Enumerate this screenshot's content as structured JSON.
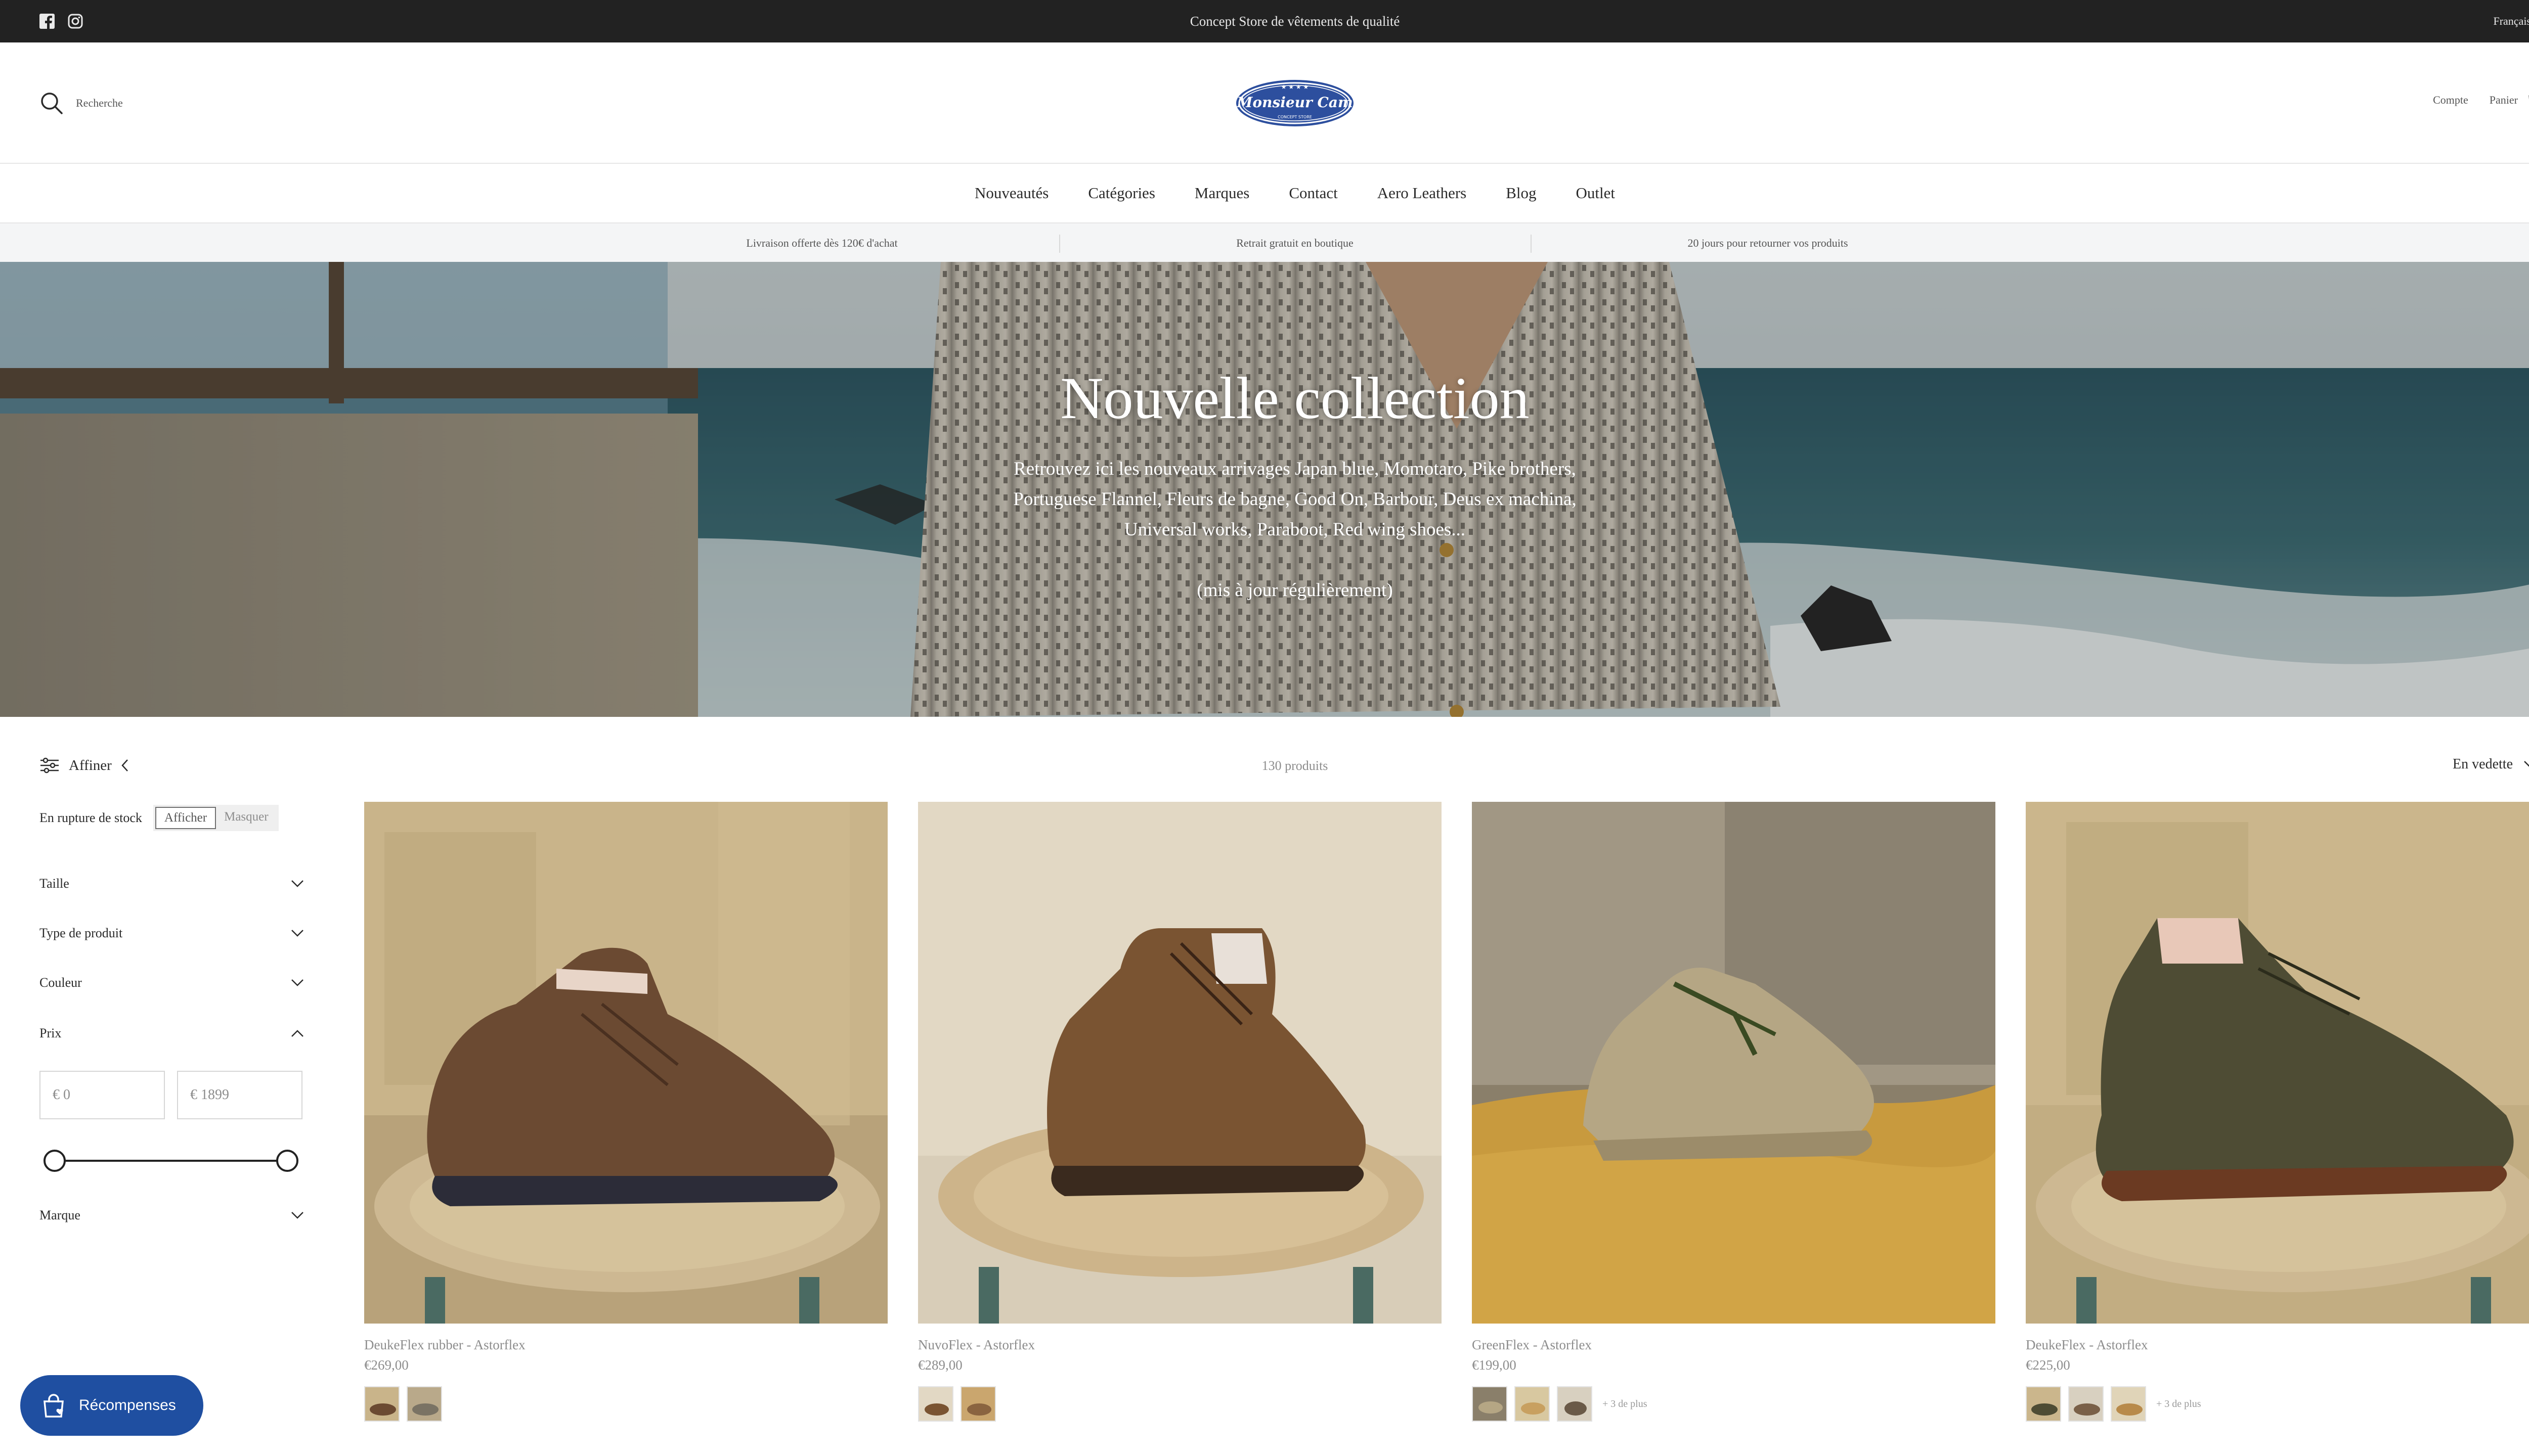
{
  "topbar": {
    "announcement": "Concept Store de vêtements de qualité",
    "language": "Français",
    "social_icons": [
      "facebook-icon",
      "instagram-icon"
    ]
  },
  "header": {
    "search_label": "Recherche",
    "logo_text": "Monsieur Cam",
    "account_label": "Compte",
    "cart_label": "Panier"
  },
  "nav": {
    "items": [
      "Nouveautés",
      "Catégories",
      "Marques",
      "Contact",
      "Aero Leathers",
      "Blog",
      "Outlet"
    ]
  },
  "usp": {
    "items": [
      "Livraison offerte dès 120€ d'achat",
      "Retrait gratuit en boutique",
      "20 jours pour retourner vos produits"
    ]
  },
  "hero": {
    "title": "Nouvelle collection",
    "description": "Retrouvez ici les nouveaux arrivages Japan blue, Momotaro, Pike brothers, Portuguese Flannel, Fleurs de bagne, Good On, Barbour, Deus ex machina, Universal works, Paraboot, Red wing shoes...",
    "note": "(mis à jour régulièrement)"
  },
  "filters": {
    "refine_label": "Affiner",
    "stock_label": "En rupture de stock",
    "stock_options": [
      "Afficher",
      "Masquer"
    ],
    "stock_selected": "Afficher",
    "facets": [
      "Taille",
      "Type de produit",
      "Couleur",
      "Prix",
      "Marque"
    ],
    "price_min": "€ 0",
    "price_max": "€ 1899"
  },
  "listing": {
    "count": "130 produits",
    "sort_label": "En vedette"
  },
  "products": [
    {
      "name": "DeukeFlex rubber - Astorflex",
      "price": "€269,00",
      "more": ""
    },
    {
      "name": "NuvoFlex - Astorflex",
      "price": "€289,00",
      "more": ""
    },
    {
      "name": "GreenFlex - Astorflex",
      "price": "€199,00",
      "more": "+ 3 de plus"
    },
    {
      "name": "DeukeFlex - Astorflex",
      "price": "€225,00",
      "more": "+ 3 de plus"
    }
  ],
  "rewards": {
    "label": "Récompenses"
  },
  "colors": {
    "topbar_bg": "#222222",
    "rewards_bg": "#1f4fa1",
    "logo_blue": "#2d4f9e"
  }
}
